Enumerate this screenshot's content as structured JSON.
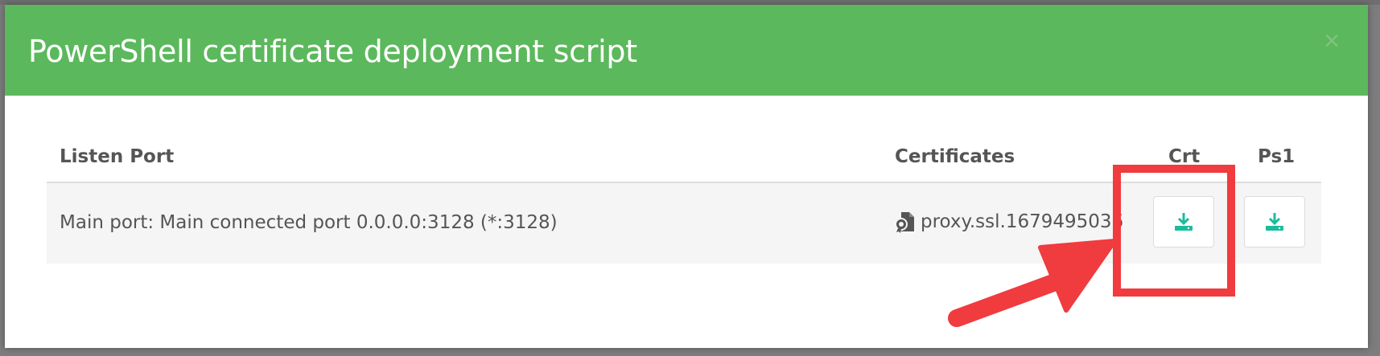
{
  "modal": {
    "title": "PowerShell certificate deployment script",
    "close_label": "×"
  },
  "table": {
    "headers": {
      "listen_port": "Listen Port",
      "certificates": "Certificates",
      "crt": "Crt",
      "ps1": "Ps1"
    },
    "rows": [
      {
        "listen_port": "Main port: Main connected port 0.0.0.0:3128 (*:3128)",
        "certificate": "proxy.ssl.1679495036",
        "crt_action": "download-icon",
        "ps1_action": "download-icon"
      }
    ]
  },
  "colors": {
    "header_bg": "#5cb85c",
    "download_icon": "#1abc9c",
    "annotation_red": "#f03b3f"
  }
}
